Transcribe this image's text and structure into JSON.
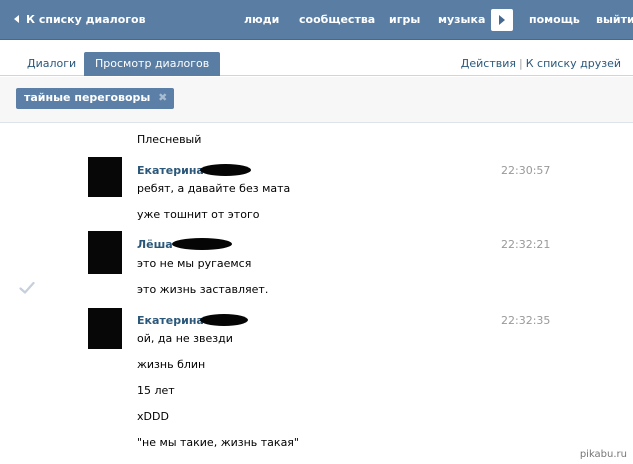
{
  "header": {
    "back_label": "К списку диалогов",
    "nav": [
      {
        "label": "люди"
      },
      {
        "label": "сообщества"
      },
      {
        "label": "игры"
      },
      {
        "label": "музыка"
      },
      {
        "label": "помощь"
      },
      {
        "label": "выйти"
      }
    ]
  },
  "tabs": [
    {
      "label": "Диалоги",
      "active": false
    },
    {
      "label": "Просмотр диалогов",
      "active": true
    }
  ],
  "right_links": {
    "actions": "Действия",
    "separator": "|",
    "friends": "К списку друзей"
  },
  "filter": {
    "tag_label": "тайные переговоры",
    "close": "✖"
  },
  "messages": {
    "prev_text": "Плесневый",
    "groups": [
      {
        "author": "Екатерина",
        "time": "22:30:57",
        "lines": [
          "ребят, а давайте без мата",
          "уже тошнит от этого"
        ]
      },
      {
        "author": "Лёша",
        "time": "22:32:21",
        "lines": [
          "это не мы ругаемся",
          "это жизнь заставляет."
        ]
      },
      {
        "author": "Екатерина",
        "time": "22:32:35",
        "lines": [
          "ой, да не звезди",
          "жизнь блин",
          "15 лет",
          "xDDD",
          "\"не мы такие, жизнь такая\""
        ]
      }
    ]
  },
  "watermark": "pikabu.ru",
  "colors": {
    "header_bg": "#597da3",
    "link": "#2b587a",
    "tag_bg": "#5b7fa6",
    "time": "#999999"
  }
}
